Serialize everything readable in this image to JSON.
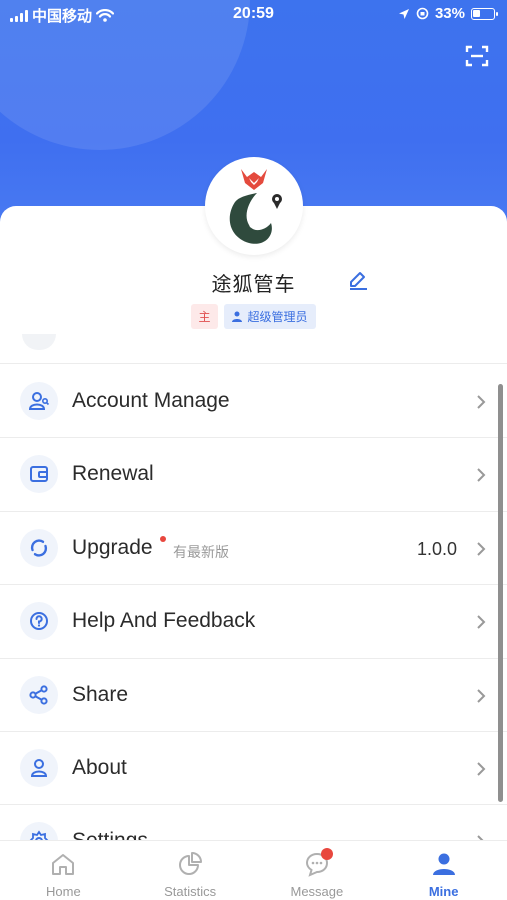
{
  "status_bar": {
    "carrier": "中国移动",
    "time": "20:59",
    "battery": "33%"
  },
  "profile": {
    "name": "途狐管车",
    "tag_main": "主",
    "tag_role": "超级管理员"
  },
  "menu": [
    {
      "label": "Account Manage",
      "icon": "user-manage-icon"
    },
    {
      "label": "Renewal",
      "icon": "wallet-icon"
    },
    {
      "label": "Upgrade",
      "icon": "refresh-icon",
      "hint": "有最新版",
      "value": "1.0.0",
      "dot": true
    },
    {
      "label": "Help And Feedback",
      "icon": "question-icon"
    },
    {
      "label": "Share",
      "icon": "share-icon"
    },
    {
      "label": "About",
      "icon": "person-icon"
    },
    {
      "label": "Settings",
      "icon": "gear-icon"
    }
  ],
  "tabs": [
    {
      "label": "Home",
      "icon": "home-icon"
    },
    {
      "label": "Statistics",
      "icon": "pie-chart-icon"
    },
    {
      "label": "Message",
      "icon": "chat-icon",
      "badge": true
    },
    {
      "label": "Mine",
      "icon": "user-icon",
      "active": true
    }
  ],
  "colors": {
    "primary": "#3b6fe0",
    "header": "#3d73ee",
    "badge": "#e8473e"
  }
}
